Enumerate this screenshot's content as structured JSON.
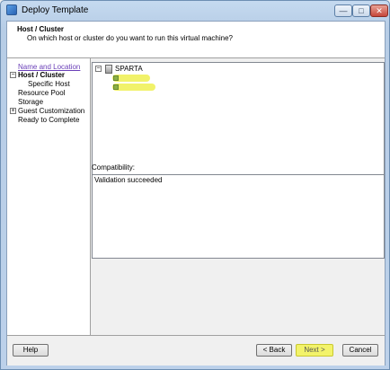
{
  "window": {
    "title": "Deploy Template",
    "controls": {
      "minimize": "—",
      "maximize": "□",
      "close": "✕"
    }
  },
  "header": {
    "title": "Host / Cluster",
    "subtitle": "On which host or cluster do you want to run this virtual machine?"
  },
  "steps": [
    {
      "label": "Name and Location",
      "state": "link"
    },
    {
      "label": "Host / Cluster",
      "state": "current"
    },
    {
      "label": "Specific Host",
      "state": "substep"
    },
    {
      "label": "Resource Pool",
      "state": "normal"
    },
    {
      "label": "Storage",
      "state": "normal"
    },
    {
      "label": "Guest Customization",
      "state": "normal"
    },
    {
      "label": "Ready to Complete",
      "state": "normal"
    }
  ],
  "expanders": {
    "collapse": "−",
    "expand": "+"
  },
  "tree": {
    "root_label": "SPARTA",
    "root_icon": "server-icon",
    "host_icon": "host-icon",
    "highlight_color": "#f1f26a"
  },
  "compatibility": {
    "label": "Compatibility:",
    "message": "Validation succeeded"
  },
  "buttons": {
    "help": "Help",
    "back": "< Back",
    "next": "Next >",
    "cancel": "Cancel"
  }
}
